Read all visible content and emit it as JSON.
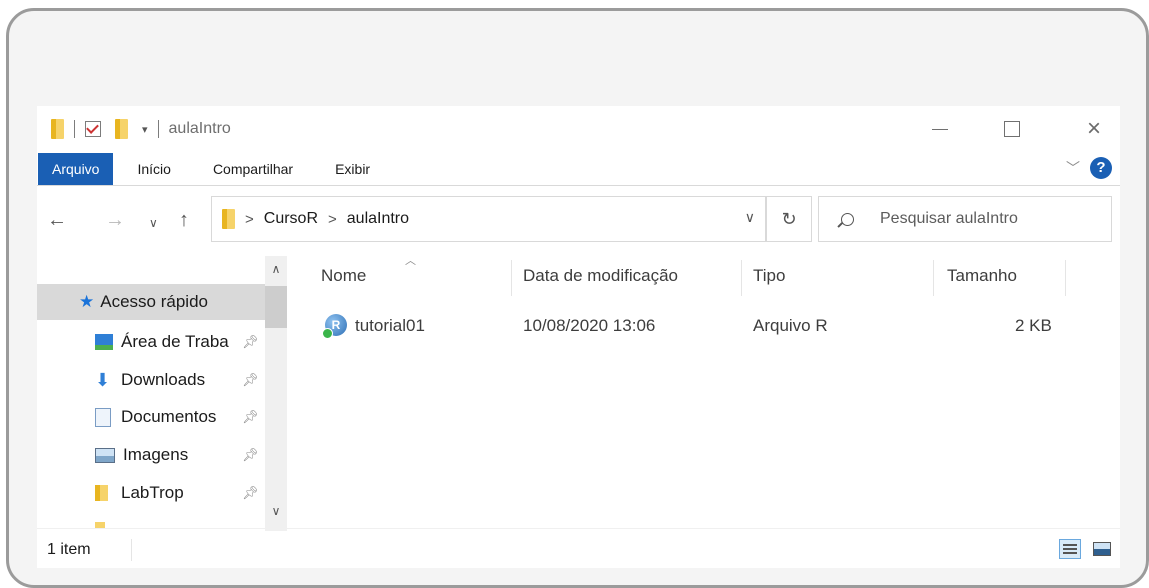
{
  "window": {
    "title": "aulaIntro",
    "accent_color": "#1a5fb4",
    "controls": {
      "minimize": "—",
      "maximize": "☐",
      "close": "✕"
    }
  },
  "ribbon": {
    "tabs": [
      {
        "label": "Arquivo"
      },
      {
        "label": "Início"
      },
      {
        "label": "Compartilhar"
      },
      {
        "label": "Exibir"
      }
    ],
    "help_label": "?"
  },
  "address": {
    "crumbs": [
      "CursoR",
      "aulaIntro"
    ],
    "separator": ">"
  },
  "search": {
    "placeholder": "Pesquisar aulaIntro"
  },
  "nav": {
    "items": [
      {
        "label": "Acesso rápido",
        "icon": "star-icon",
        "pinned": false
      },
      {
        "label": "Área de Traba",
        "icon": "desktop-icon",
        "pinned": true
      },
      {
        "label": "Downloads",
        "icon": "download-icon",
        "pinned": true
      },
      {
        "label": "Documentos",
        "icon": "document-icon",
        "pinned": true
      },
      {
        "label": "Imagens",
        "icon": "image-icon",
        "pinned": true
      },
      {
        "label": "LabTrop",
        "icon": "folder-icon",
        "pinned": true
      }
    ]
  },
  "columns": [
    "Nome",
    "Data de modificação",
    "Tipo",
    "Tamanho"
  ],
  "files": [
    {
      "name": "tutorial01",
      "modified": "10/08/2020 13:06",
      "type": "Arquivo R",
      "size": "2 KB",
      "icon": "r-file-icon"
    }
  ],
  "status": {
    "count": "1 item"
  }
}
